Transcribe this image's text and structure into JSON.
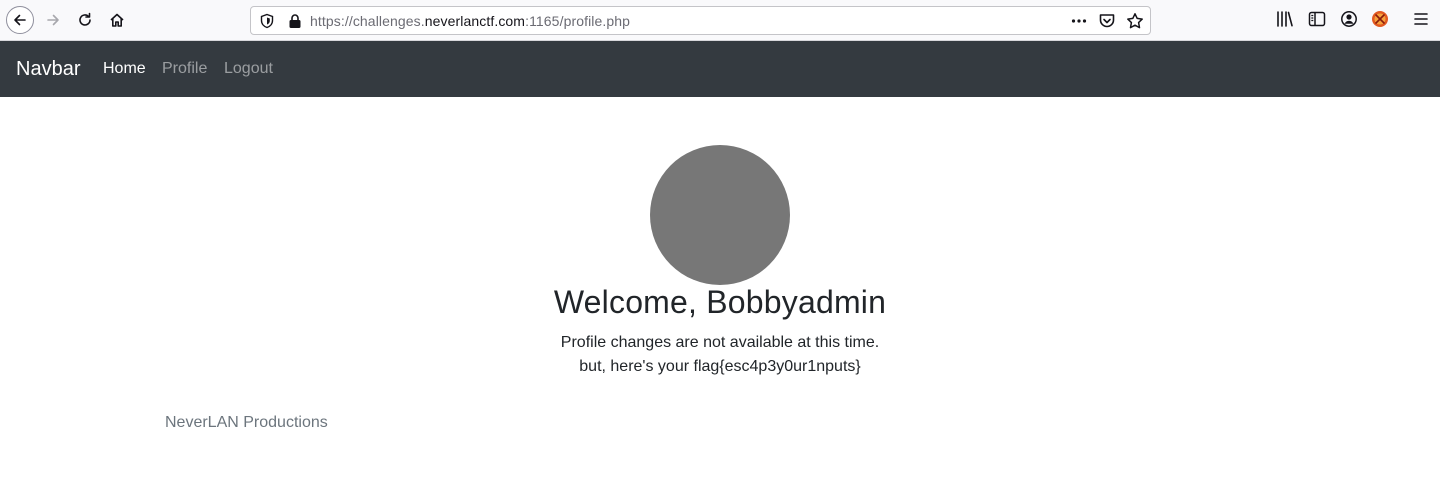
{
  "browser": {
    "url": {
      "prefix": "https://challenges.",
      "domain": "neverlanctf.com",
      "suffix": ":1165/profile.php"
    },
    "icons": [
      "back-icon",
      "forward-icon",
      "reload-icon",
      "home-icon",
      "shield-icon",
      "lock-icon",
      "more-icon",
      "pocket-icon",
      "star-icon",
      "library-icon",
      "sidebar-icon",
      "account-icon",
      "extension-icon",
      "menu-icon"
    ]
  },
  "navbar": {
    "brand": "Navbar",
    "links": [
      {
        "label": "Home",
        "active": true
      },
      {
        "label": "Profile",
        "active": false
      },
      {
        "label": "Logout",
        "active": false
      }
    ]
  },
  "main": {
    "welcome": "Welcome, Bobbyadmin",
    "message_line1": "Profile changes are not available at this time.",
    "message_line2": "but, here's your flag{esc4p3y0ur1nputs}",
    "avatar_color": "#777777"
  },
  "footer": {
    "text": "NeverLAN Productions"
  },
  "colors": {
    "navbar_bg": "#343a40",
    "text": "#212529",
    "muted": "#6c757d"
  }
}
